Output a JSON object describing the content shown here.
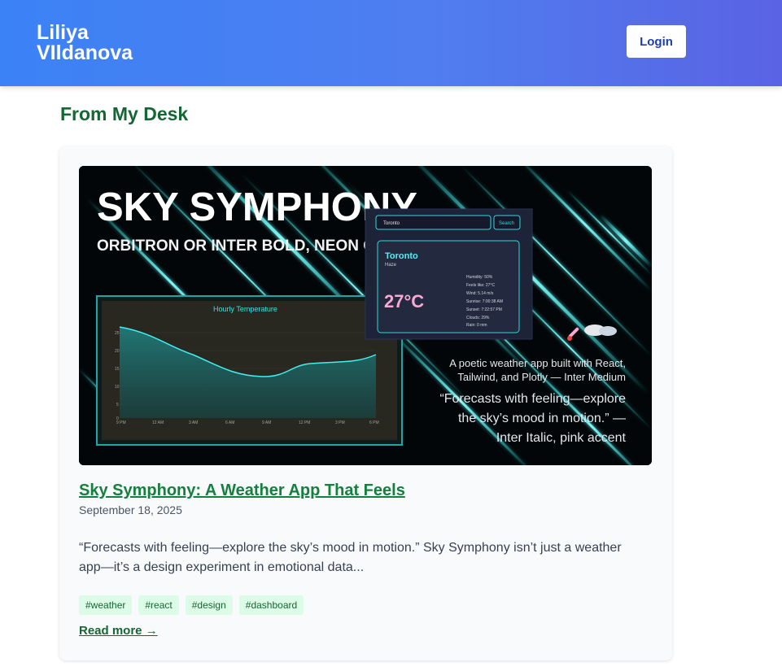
{
  "header": {
    "logo_line1": "Liliya",
    "logo_line2": "VIldanova",
    "login_label": "Login",
    "theme_icon": "moon-icon"
  },
  "section": {
    "title": "From My Desk"
  },
  "post": {
    "title": "Sky Symphony: A Weather App That Feels",
    "date": "September 18, 2025",
    "excerpt": "“Forecasts with feeling—explore the sky’s mood in motion.” Sky Symphony isn’t just a weather app—it’s a design experiment in emotional data...",
    "tags": [
      "#weather",
      "#react",
      "#design",
      "#dashboard"
    ],
    "read_more": "Read more →",
    "image": {
      "headline": "SKY SYMPHONY",
      "subheadline": "ORBITRON OR INTER BOLD, NEON CYAN",
      "chart_title": "Hourly Temperature",
      "chart_y_ticks": [
        "25",
        "20",
        "15",
        "10",
        "5",
        "0"
      ],
      "chart_x_ticks": [
        "9 PM",
        "12 AM",
        "3 AM",
        "6 AM",
        "9 AM",
        "12 PM",
        "3 PM",
        "6 PM"
      ],
      "search_value": "Toronto",
      "search_button": "Search",
      "city": "Toronto",
      "condition": "Haze",
      "temperature": "27°C",
      "details": [
        "Humidity: 50%",
        "Feels like: 27°C",
        "Wind: 5.14 m/s",
        "Sunrise: 7:00:38 AM",
        "Sunset: 7:22:57 PM",
        "Clouds: 29%",
        "Rain: 0 mm"
      ],
      "caption_line1": "A poetic weather app built with React,",
      "caption_line2": "Tailwind, and Plotly — Inter Medium",
      "quote_line1": "“Forecasts with feeling—explore",
      "quote_line2": "the sky’s mood in motion.” —",
      "quote_line3": "Inter Italic, pink accent"
    }
  },
  "colors": {
    "header_start": "#3b82f6",
    "header_end": "#5a63e3",
    "accent_green": "#166534",
    "neon_cyan": "#22e5e5",
    "pink_accent": "#f9a8d4"
  }
}
